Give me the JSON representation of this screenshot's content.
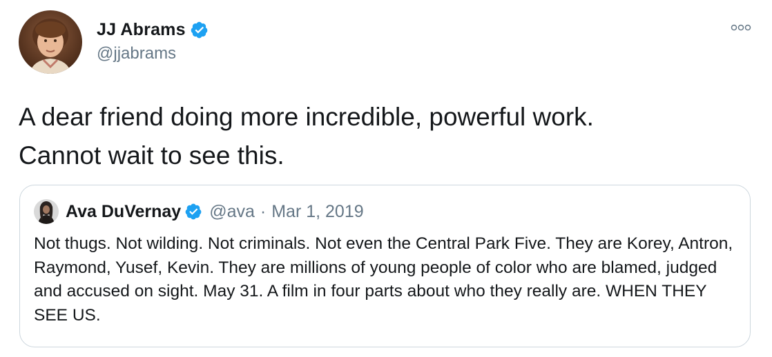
{
  "tweet": {
    "author": {
      "display_name": "JJ Abrams",
      "handle": "@jjabrams",
      "verified": true
    },
    "text": "A dear friend doing more incredible, powerful work.\nCannot wait to see this.",
    "quoted_tweet": {
      "author": {
        "display_name": "Ava DuVernay",
        "handle": "@ava",
        "verified": true
      },
      "separator": "·",
      "date": "Mar 1, 2019",
      "text": "Not thugs. Not wilding. Not criminals. Not even the Central Park Five. They are Korey, Antron, Raymond, Yusef, Kevin. They are millions of young people of color who are blamed, judged and accused on sight. May 31. A film in four parts about who they really are. WHEN THEY SEE US."
    }
  },
  "colors": {
    "text_primary": "#14171a",
    "text_secondary": "#657786",
    "verified_blue": "#1da1f2",
    "border": "#ccd6dd"
  },
  "icons": {
    "verified": "verified-badge-icon",
    "more": "more-options-icon"
  }
}
